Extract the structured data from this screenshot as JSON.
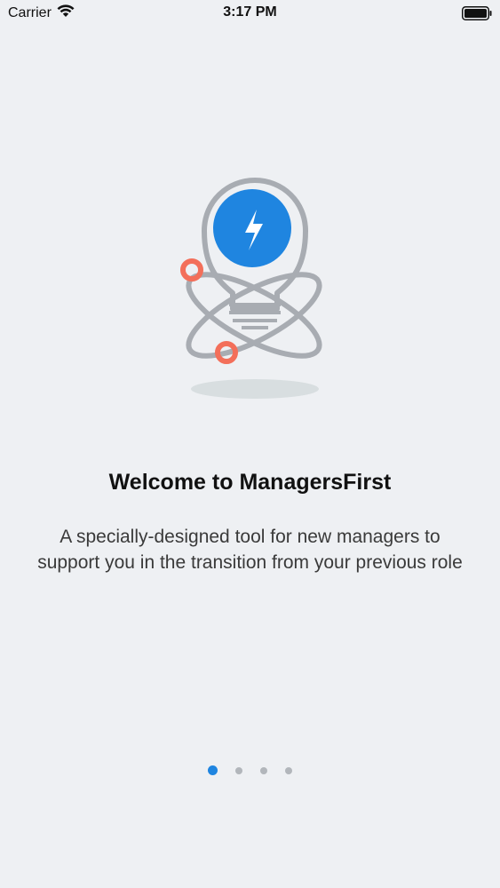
{
  "status_bar": {
    "carrier": "Carrier",
    "time": "3:17 PM",
    "icons": [
      "wifi-icon",
      "battery-icon"
    ]
  },
  "onboarding": {
    "illustration": "lightbulb-atom-illustration",
    "title": "Welcome to ManagersFirst",
    "description": "A specially-designed tool for new managers to support you in the transition from your previous role"
  },
  "pagination": {
    "total_pages": 4,
    "current_page": 1,
    "colors": {
      "active": "#1f85e0",
      "inactive": "#b2b6bb"
    }
  },
  "colors": {
    "background": "#eef0f3",
    "accent": "#1f85e0",
    "orbit_marker": "#f36f5a",
    "line": "#a8acb2"
  }
}
